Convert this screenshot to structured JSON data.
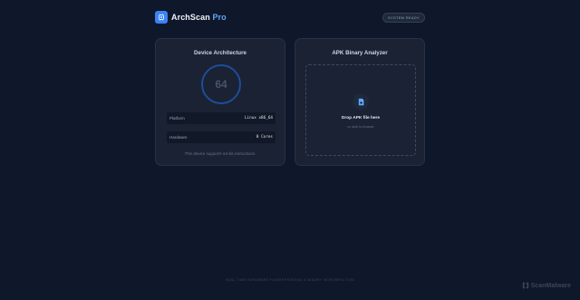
{
  "header": {
    "brand": "ArchScan",
    "brand_suffix": "Pro",
    "status": "SYSTEM READY"
  },
  "architecture_card": {
    "title": "Device Architecture",
    "bits": "64",
    "rows": [
      {
        "label": "Platform",
        "value": "Linux x86_64"
      },
      {
        "label": "Hardware",
        "value": "8 Cores"
      }
    ],
    "note": "This device supports 64-bit instructions."
  },
  "analyzer_card": {
    "title": "APK Binary Analyzer",
    "drop_title": "Drop APK file here",
    "drop_subtitle": "or click to browse"
  },
  "footer": {
    "text": "REAL-TIME HARDWARE FINGERPRINTING & BINARY INTROSPECTION"
  },
  "watermark": "ScanMalware",
  "colors": {
    "accent": "#3b82f6",
    "background": "#0f172a",
    "card": "#1a2233"
  }
}
